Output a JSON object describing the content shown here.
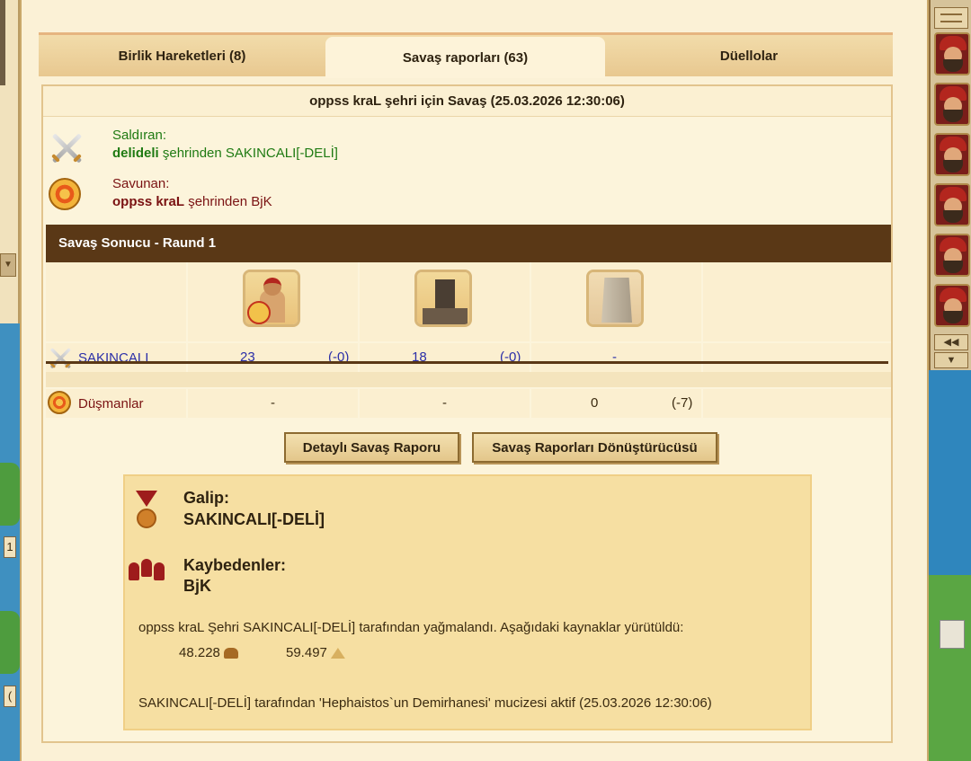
{
  "tabs": [
    {
      "label": "Birlik Hareketleri (8)"
    },
    {
      "label": "Savaş raporları (63)"
    },
    {
      "label": "Düellolar"
    }
  ],
  "report": {
    "title": "oppss kraL şehri için Savaş (25.03.2026 12:30:06)",
    "attacker": {
      "label": "Saldıran:",
      "city": "delideli",
      "city_suffix": "şehrinden SAKINCALI[-DELİ]"
    },
    "defender": {
      "label": "Savunan:",
      "city": "oppss kraL",
      "city_suffix": "şehrinden BjK"
    },
    "section_title": "Savaş Sonucu - Raund 1",
    "units": [
      "hoplite-icon",
      "catapult-icon",
      "wall-icon"
    ],
    "rows": [
      {
        "name": "SAKINCALI",
        "cells": [
          {
            "count": "23",
            "loss": "(-0)"
          },
          {
            "count": "18",
            "loss": "(-0)"
          },
          {
            "count": "-",
            "loss": ""
          }
        ]
      },
      {
        "name": "Düşmanlar",
        "cells": [
          {
            "count": "-",
            "loss": ""
          },
          {
            "count": "-",
            "loss": ""
          },
          {
            "count": "0",
            "loss": "(-7)"
          }
        ]
      }
    ]
  },
  "buttons": {
    "detailed": "Detaylı Savaş Raporu",
    "converter": "Savaş Raporları Dönüştürücüsü"
  },
  "result": {
    "winner_label": "Galip:",
    "winner": "SAKINCALI[-DELİ]",
    "losers_label": "Kaybedenler:",
    "losers": "BjK",
    "plunder_text": "oppss kraL Şehri SAKINCALI[-DELİ] tarafından yağmalandı. Aşağıdaki kaynaklar yürütüldü:",
    "resources": [
      {
        "amount": "48.228",
        "icon": "wood-icon"
      },
      {
        "amount": "59.497",
        "icon": "stone-icon"
      }
    ],
    "wonder_text": "SAKINCALI[-DELİ] tarafından 'Hephaistos`un Demirhanesi' mucizesi aktif (25.03.2026 12:30:06)"
  },
  "side": {
    "left_marker_1": "1",
    "left_marker_2": "(",
    "scroll_up": "◀◀",
    "scroll_down": "▼"
  },
  "colors": {
    "header_bar": "#5a3816",
    "attacker_green": "#1f7a12",
    "defender_red": "#7a1212",
    "number_blue": "#2b2fa8"
  }
}
